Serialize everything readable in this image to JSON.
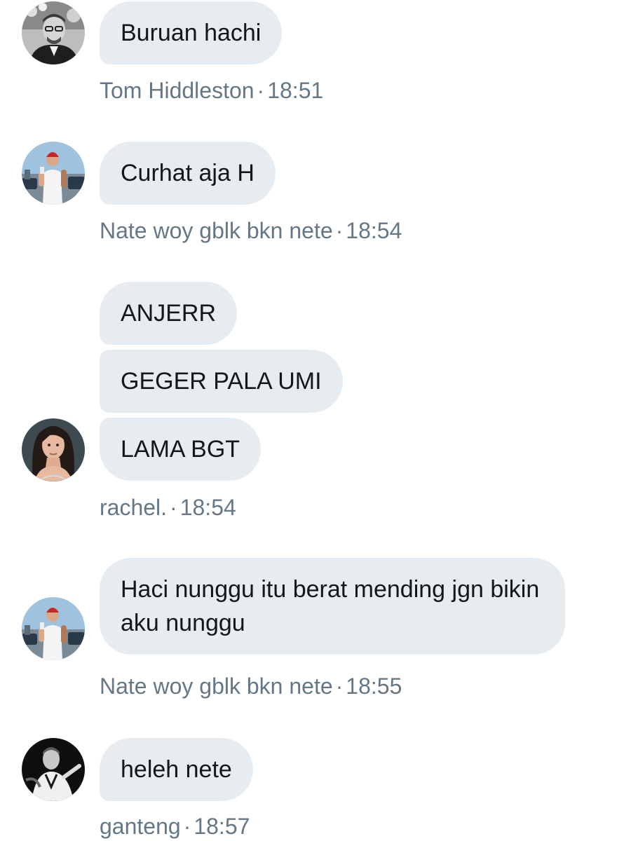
{
  "messages": [
    {
      "sender": "Tom Hiddleston",
      "time": "18:51",
      "avatar_icon": "man-glasses-avatar-icon",
      "texts": [
        "Buruan hachi"
      ]
    },
    {
      "sender": "Nate woy gblk bkn nete",
      "time": "18:54",
      "avatar_icon": "man-red-beanie-avatar-icon",
      "texts": [
        "Curhat aja H"
      ]
    },
    {
      "sender": "rachel.",
      "time": "18:54",
      "avatar_icon": "woman-dark-hair-avatar-icon",
      "texts": [
        "ANJERR",
        "GEGER PALA UMI",
        "LAMA BGT"
      ]
    },
    {
      "sender": "Nate woy gblk bkn nete",
      "time": "18:55",
      "avatar_icon": "man-red-beanie-avatar-icon",
      "texts": [
        "Haci nunggu itu berat mending jgn bikin aku nunggu"
      ]
    },
    {
      "sender": "ganteng",
      "time": "18:57",
      "avatar_icon": "man-monochrome-avatar-icon",
      "texts": [
        "heleh nete"
      ]
    }
  ],
  "separator": "·",
  "colors": {
    "bubble_bg": "#e6ecf0",
    "bubble_text": "#14171a",
    "meta_text": "#657786"
  }
}
